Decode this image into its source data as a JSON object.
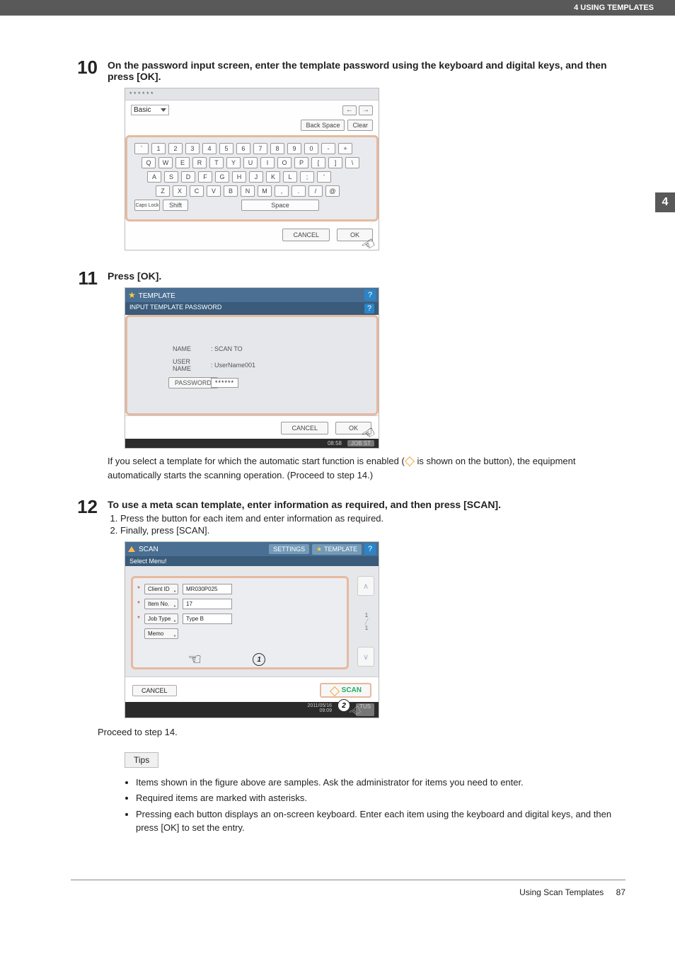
{
  "header": {
    "section": "4 USING TEMPLATES"
  },
  "side_tab": "4",
  "steps": {
    "s10": {
      "num": "10",
      "title": "On the password input screen, enter the template password using the keyboard and digital keys, and then press [OK].",
      "keyboard": {
        "masked": "* * * * * *",
        "dropdown": "Basic",
        "back_space": "Back Space",
        "clear": "Clear",
        "nav_left": "←",
        "nav_right": "→",
        "row1": [
          "`",
          "1",
          "2",
          "3",
          "4",
          "5",
          "6",
          "7",
          "8",
          "9",
          "0",
          "-",
          "+"
        ],
        "row2": [
          "Q",
          "W",
          "E",
          "R",
          "T",
          "Y",
          "U",
          "I",
          "O",
          "P",
          "[",
          "]",
          "\\"
        ],
        "row3": [
          "A",
          "S",
          "D",
          "F",
          "G",
          "H",
          "J",
          "K",
          "L",
          ";",
          "'"
        ],
        "row4": [
          "Z",
          "X",
          "C",
          "V",
          "B",
          "N",
          "M",
          ",",
          ".",
          "/",
          "@"
        ],
        "caps": "Caps Lock",
        "shift": "Shift",
        "space": "Space",
        "cancel": "CANCEL",
        "ok": "OK"
      }
    },
    "s11": {
      "num": "11",
      "title": "Press [OK].",
      "template": {
        "header": "TEMPLATE",
        "sub": "INPUT TEMPLATE PASSWORD",
        "name_label": "NAME",
        "name_val": ": SCAN TO",
        "user_label": "USER NAME",
        "user_val": ": UserName001",
        "pw_label": "PASSWORD",
        "pw_val": "******",
        "cancel": "CANCEL",
        "ok": "OK",
        "time": "08:58",
        "jobstatus": "JOB ST"
      },
      "note": "If you select a template for which the automatic start function is enabled ( is shown on the button), the equipment automatically starts the scanning operation. (Proceed to step 14.)"
    },
    "s12": {
      "num": "12",
      "title": "To use a meta scan template, enter information as required, and then press [SCAN].",
      "sub1": "Press the button for each item and enter information as required.",
      "sub2": "Finally, press [SCAN].",
      "scan": {
        "header": "SCAN",
        "settings": "SETTINGS",
        "template": "TEMPLATE",
        "sub": "Select Menu!",
        "items": [
          {
            "req": "*",
            "label": "Client ID",
            "val": "MR030P025"
          },
          {
            "req": "*",
            "label": "Item No.",
            "val": "17"
          },
          {
            "req": "*",
            "label": "Job Type",
            "val": "Type B"
          },
          {
            "req": "",
            "label": "Memo",
            "val": ""
          }
        ],
        "page_top": "1",
        "page_bot": "1",
        "cancel": "CANCEL",
        "scanbtn": "SCAN",
        "date": "2011/05/16\n09:09",
        "status": "TUS"
      },
      "proceed": "Proceed to step 14."
    }
  },
  "tips": {
    "heading": "Tips",
    "items": [
      "Items shown in the figure above are samples. Ask the administrator for items you need to enter.",
      "Required items are marked with asterisks.",
      "Pressing each button displays an on-screen keyboard. Enter each item using the keyboard and digital keys, and then press [OK] to set the entry."
    ]
  },
  "footer": {
    "title": "Using Scan Templates",
    "page": "87"
  }
}
